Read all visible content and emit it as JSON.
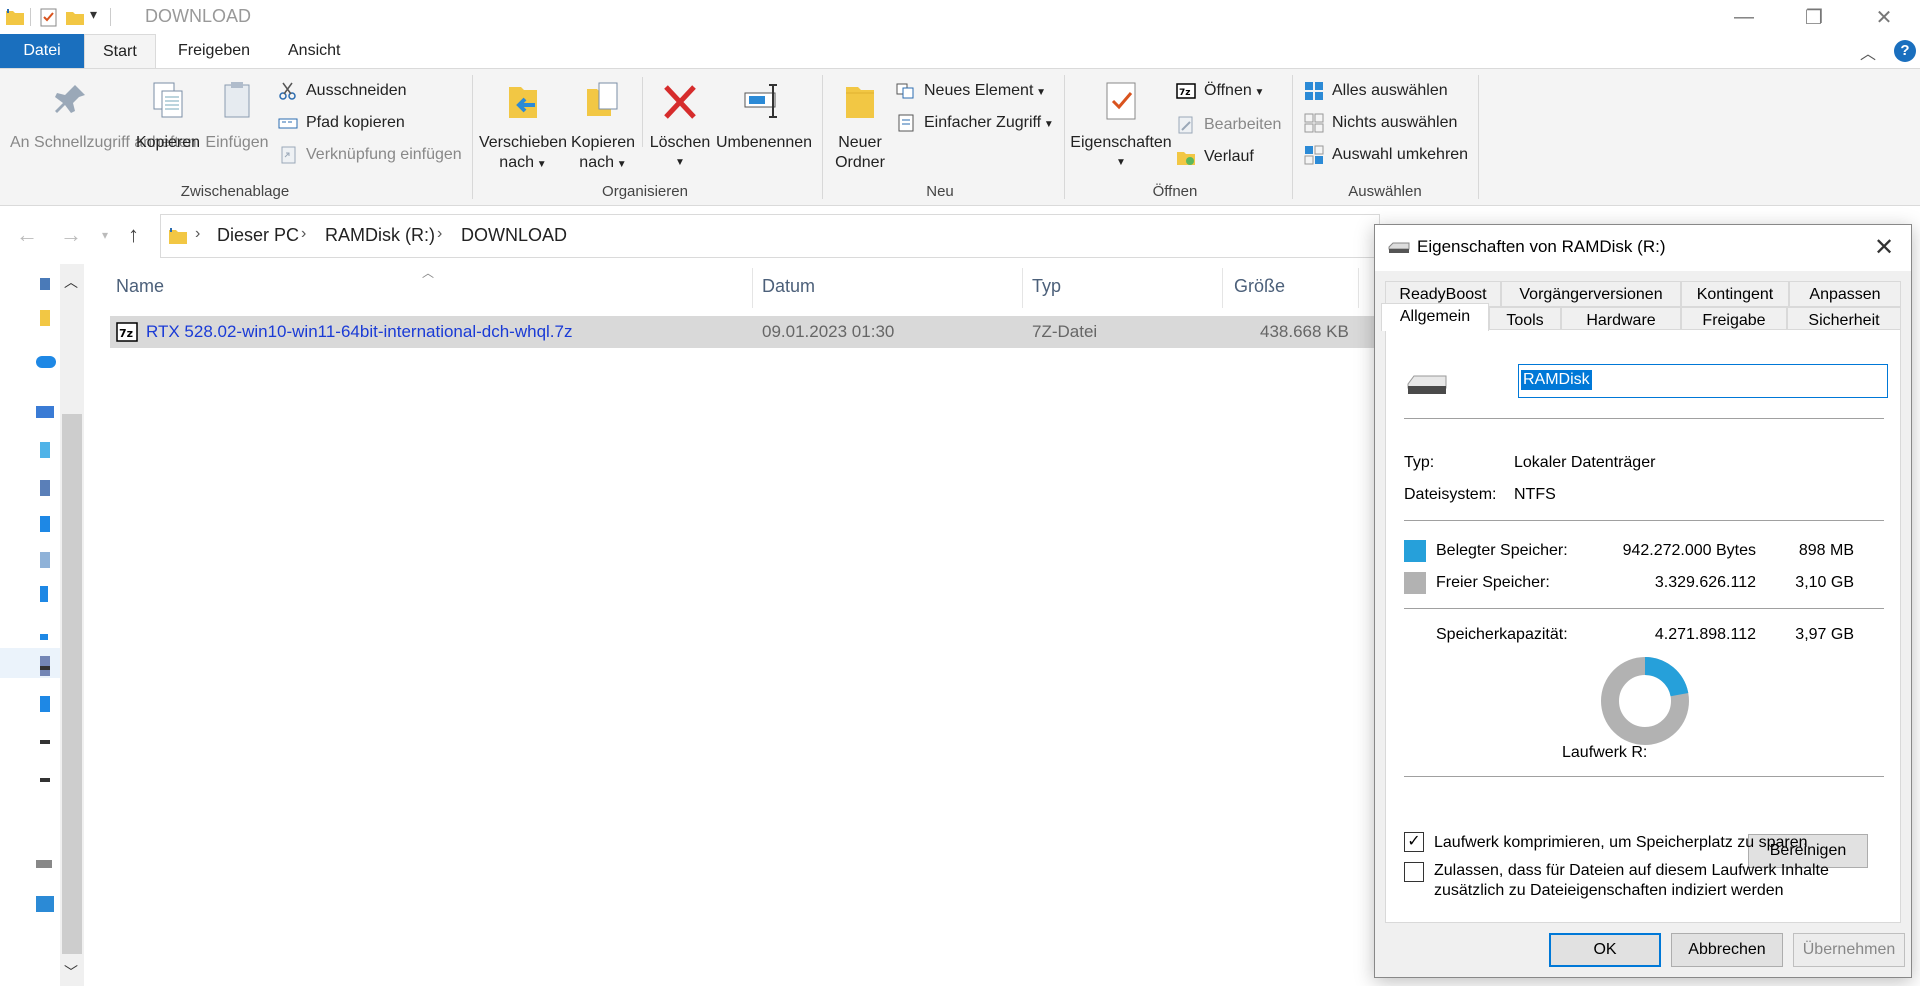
{
  "window": {
    "title": "DOWNLOAD",
    "controls": {
      "minimize": "—",
      "restore": "❐",
      "close": "✕"
    }
  },
  "ribbon": {
    "tabs": [
      "Datei",
      "Start",
      "Freigeben",
      "Ansicht"
    ],
    "active_tab": "Start",
    "groups": {
      "clipboard": {
        "label": "Zwischenablage",
        "pin": "An Schnellzugriff anheften",
        "copy": "Kopieren",
        "paste": "Einfügen",
        "cut": "Ausschneiden",
        "copy_path": "Pfad kopieren",
        "paste_shortcut": "Verknüpfung einfügen"
      },
      "organize": {
        "label": "Organisieren",
        "move_to_1": "Verschieben",
        "move_to_2": "nach",
        "copy_to_1": "Kopieren",
        "copy_to_2": "nach",
        "delete": "Löschen",
        "rename": "Umbenennen"
      },
      "new": {
        "label": "Neu",
        "new_folder_1": "Neuer",
        "new_folder_2": "Ordner",
        "new_item": "Neues Element",
        "easy_access": "Einfacher Zugriff"
      },
      "open": {
        "label": "Öffnen",
        "properties": "Eigenschaften",
        "open": "Öffnen",
        "edit": "Bearbeiten",
        "history": "Verlauf"
      },
      "select": {
        "label": "Auswählen",
        "select_all": "Alles auswählen",
        "select_none": "Nichts auswählen",
        "invert": "Auswahl umkehren"
      }
    }
  },
  "address": {
    "crumbs": [
      "Dieser PC",
      "RAMDisk (R:)",
      "DOWNLOAD"
    ]
  },
  "filelist": {
    "columns": [
      "Name",
      "Datum",
      "Typ",
      "Größe"
    ],
    "rows": [
      {
        "name": "RTX 528.02-win10-win11-64bit-international-dch-whql.7z",
        "date": "09.01.2023 01:30",
        "type": "7Z-Datei",
        "size": "438.668 KB"
      }
    ]
  },
  "dialog": {
    "title": "Eigenschaften von RAMDisk (R:)",
    "tabs_row1": [
      "ReadyBoost",
      "Vorgängerversionen",
      "Kontingent",
      "Anpassen"
    ],
    "tabs_row2": [
      "Allgemein",
      "Tools",
      "Hardware",
      "Freigabe",
      "Sicherheit"
    ],
    "active_tab": "Allgemein",
    "name_value": "RAMDisk",
    "type_label": "Typ:",
    "type_value": "Lokaler Datenträger",
    "fs_label": "Dateisystem:",
    "fs_value": "NTFS",
    "used_label": "Belegter Speicher:",
    "used_bytes": "942.272.000 Bytes",
    "used_size": "898 MB",
    "free_label": "Freier Speicher:",
    "free_bytes": "3.329.626.112",
    "free_size": "3,10 GB",
    "capacity_label": "Speicherkapazität:",
    "capacity_bytes": "4.271.898.112",
    "capacity_size": "3,97 GB",
    "used_fraction": 0.2206,
    "drive_label": "Laufwerk R:",
    "cleanup_button": "Bereinigen",
    "compress_label": "Laufwerk komprimieren, um Speicherplatz zu sparen",
    "compress_checked": true,
    "index_label_1": "Zulassen, dass für Dateien auf diesem Laufwerk Inhalte",
    "index_label_2": "zusätzlich zu Dateieigenschaften indiziert werden",
    "index_checked": false,
    "ok": "OK",
    "cancel": "Abbrechen",
    "apply": "Übernehmen",
    "colors": {
      "used": "#26a0da",
      "free": "#b2b2b2"
    }
  }
}
